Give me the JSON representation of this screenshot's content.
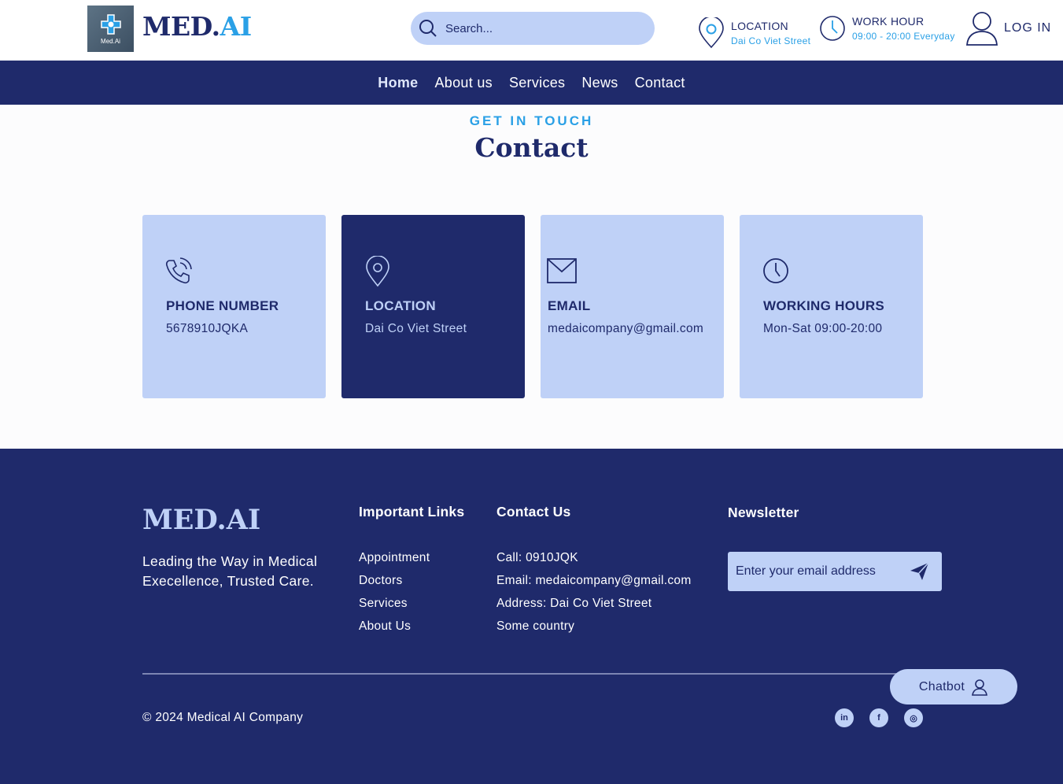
{
  "header": {
    "logo_text": "Med.Ai",
    "brand_main": "MED.",
    "brand_accent": "AI",
    "search_placeholder": "Search...",
    "location_title": "LOCATION",
    "location_value": "Dai Co Viet Street",
    "workhour_title": "WORK HOUR",
    "workhour_value": "09:00 - 20:00 Everyday",
    "login_label": "LOG IN"
  },
  "nav": {
    "items": [
      {
        "label": "Home",
        "active": true
      },
      {
        "label": "About us"
      },
      {
        "label": "Services"
      },
      {
        "label": "News"
      },
      {
        "label": "Contact"
      }
    ]
  },
  "section": {
    "kicker": "GET IN TOUCH",
    "title": "Contact"
  },
  "cards": [
    {
      "icon": "phone-icon",
      "title": "PHONE NUMBER",
      "value": "5678910JQKA"
    },
    {
      "icon": "location-pin-icon",
      "title": "LOCATION",
      "value": "Dai Co Viet Street"
    },
    {
      "icon": "mail-icon",
      "title": "EMAIL",
      "value": "medaicompany@gmail.com"
    },
    {
      "icon": "clock-icon",
      "title": "WORKING HOURS",
      "value": "Mon-Sat 09:00-20:00"
    }
  ],
  "footer": {
    "brand": "MED.AI",
    "tagline": "Leading the Way in Medical Execellence, Trusted Care.",
    "links_heading": "Important Links",
    "links": [
      "Appointment",
      "Doctors",
      "Services",
      "About Us"
    ],
    "contact_heading": "Contact Us",
    "contact": [
      "Call: 0910JQK",
      "Email: medaicompany@gmail.com",
      "Address: Dai Co Viet Street",
      "Some country"
    ],
    "newsletter_heading": "Newsletter",
    "newsletter_placeholder": "Enter your email address",
    "copyright": "© 2024 Medical AI Company",
    "social": [
      {
        "icon": "linkedin-icon",
        "glyph": "in"
      },
      {
        "icon": "facebook-icon",
        "glyph": "f"
      },
      {
        "icon": "instagram-icon",
        "glyph": "◎"
      }
    ],
    "chatbot_label": "Chatbot"
  },
  "colors": {
    "navy": "#1f2a6b",
    "light_blue": "#bfd1f7",
    "accent": "#2aa0e6"
  }
}
